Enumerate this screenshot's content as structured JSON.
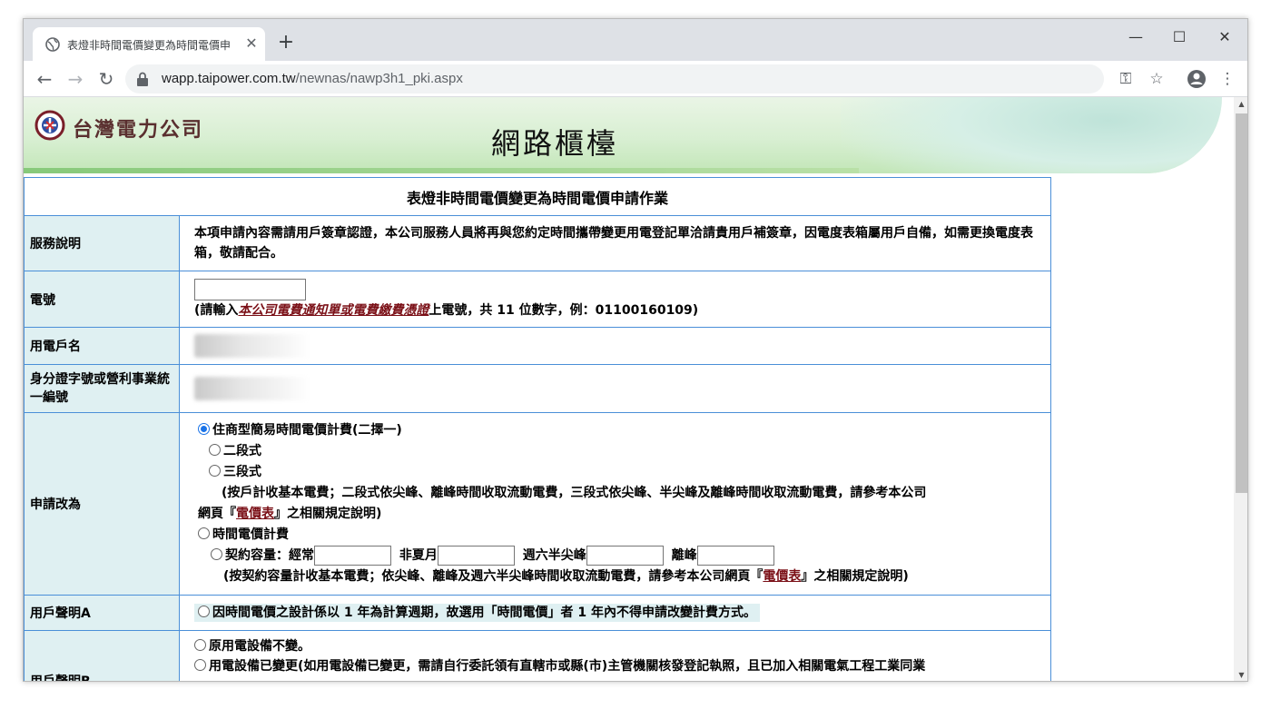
{
  "browser": {
    "tab_title": "表燈非時間電價變更為時間電價申",
    "new_tab": "+",
    "url_host": "wapp.taipower.com.tw",
    "url_path": "/newnas/nawp3h1_pki.aspx",
    "window_min": "—",
    "window_max": "☐",
    "window_close": "✕"
  },
  "banner": {
    "company": "台灣電力公司",
    "site_title": "網路櫃檯"
  },
  "form": {
    "title": "表燈非時間電價變更為時間電價申請作業",
    "service_label": "服務說明",
    "service_text": "本項申請內容需請用戶簽章認證，本公司服務人員將再與您約定時間攜帶變更用電登記單洽請貴用戶補簽章，因電度表箱屬用戶自備，如需更換電度表箱，敬請配合。",
    "account_label": "電號",
    "account_hint_pre": "(請輸入",
    "account_hint_link": "本公司電費通知單或電費繳費憑證",
    "account_hint_post": "上電號，共 11 位數字，例：01100160109)",
    "name_label": "用電戶名",
    "id_label": "身分證字號或營利事業統一編號",
    "change_label": "申請改為",
    "opt1": "住商型簡易時間電價計費(二擇一)",
    "opt1a": "二段式",
    "opt1b": "三段式",
    "opt1_note_1": "(按戶計收基本電費；二段式依尖峰、離峰時間收取流動電費，三段式依尖峰、半尖峰及離峰時間收取流動電費，請參考本公司",
    "opt1_note_2_pre": "網頁『",
    "opt1_note_2_link": "電價表",
    "opt1_note_2_post": "』之相關規定說明)",
    "opt2": "時間電價計費",
    "opt2_contract": "契約容量：經常",
    "opt2_nonsummer": "非夏月",
    "opt2_saturday": "週六半尖峰",
    "opt2_offpeak": "離峰",
    "opt2_note_pre": "(按契約容量計收基本電費；依尖峰、離峰及週六半尖峰時間收取流動電費，請參考本公司網頁『",
    "opt2_note_link": "電價表",
    "opt2_note_post": "』之相關規定說明)",
    "declA_label": "用戶聲明A",
    "declA_text": "因時間電價之設計係以 1 年為計算週期，故選用「時間電價」者 1 年內不得申請改變計費方式。",
    "declB_label": "用戶聲明B",
    "declB_opt1": "原用電設備不變。",
    "declB_opt2": "用電設備已變更(如用電設備已變更，需請自行委託領有直轄市或縣(市)主管機關核發登記執照，且已加入相關電氣工程工業同業"
  },
  "colors": {
    "table_border": "#4a8fd8",
    "label_bg": "#dff0f2",
    "link": "#7a0f16",
    "radio_selected": "#1a73e8"
  }
}
